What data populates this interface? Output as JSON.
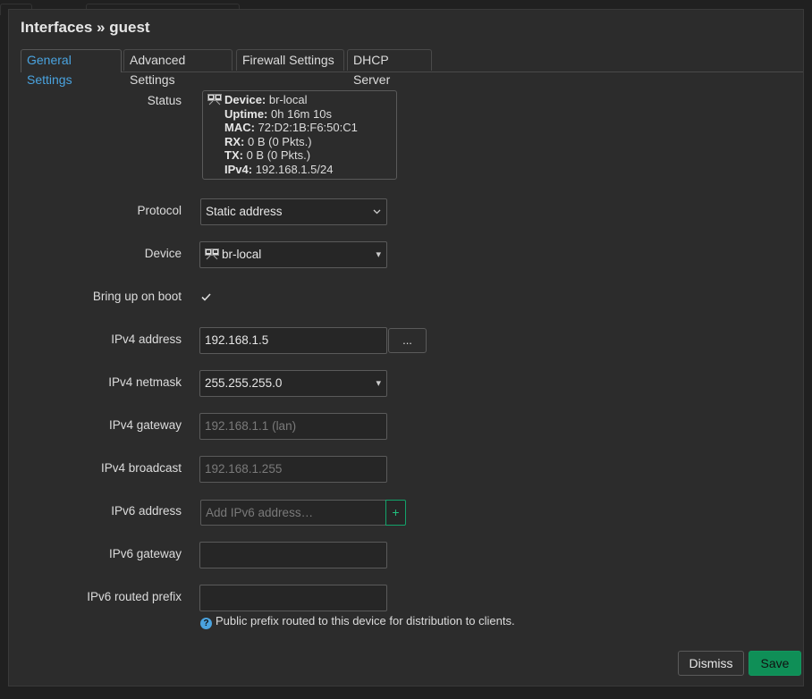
{
  "dialog": {
    "title": "Interfaces » guest",
    "tabs": [
      {
        "label": "General Settings",
        "active": true
      },
      {
        "label": "Advanced Settings",
        "active": false
      },
      {
        "label": "Firewall Settings",
        "active": false
      },
      {
        "label": "DHCP Server",
        "active": false
      }
    ]
  },
  "status": {
    "label": "Status",
    "device_key": "Device:",
    "device_val": "br-local",
    "uptime_key": "Uptime:",
    "uptime_val": "0h 16m 10s",
    "mac_key": "MAC:",
    "mac_val": "72:D2:1B:F6:50:C1",
    "rx_key": "RX:",
    "rx_val": "0 B (0 Pkts.)",
    "tx_key": "TX:",
    "tx_val": "0 B (0 Pkts.)",
    "ipv4_key": "IPv4:",
    "ipv4_val": "192.168.1.5/24"
  },
  "form": {
    "protocol": {
      "label": "Protocol",
      "value": "Static address"
    },
    "device": {
      "label": "Device",
      "value": "br-local"
    },
    "boot": {
      "label": "Bring up on boot",
      "checked": true
    },
    "ipv4_address": {
      "label": "IPv4 address",
      "value": "192.168.1.5",
      "more": "..."
    },
    "ipv4_netmask": {
      "label": "IPv4 netmask",
      "value": "255.255.255.0"
    },
    "ipv4_gateway": {
      "label": "IPv4 gateway",
      "placeholder": "192.168.1.1 (lan)"
    },
    "ipv4_broadcast": {
      "label": "IPv4 broadcast",
      "placeholder": "192.168.1.255"
    },
    "ipv6_address": {
      "label": "IPv6 address",
      "placeholder": "Add IPv6 address…",
      "add": "+"
    },
    "ipv6_gateway": {
      "label": "IPv6 gateway",
      "value": ""
    },
    "ipv6_prefix": {
      "label": "IPv6 routed prefix",
      "value": "",
      "hint": "Public prefix routed to this device for distribution to clients."
    }
  },
  "footer": {
    "dismiss": "Dismiss",
    "save": "Save"
  },
  "colors": {
    "accent": "#4aa3df",
    "save": "#0f8f57",
    "add": "#22c17f"
  }
}
